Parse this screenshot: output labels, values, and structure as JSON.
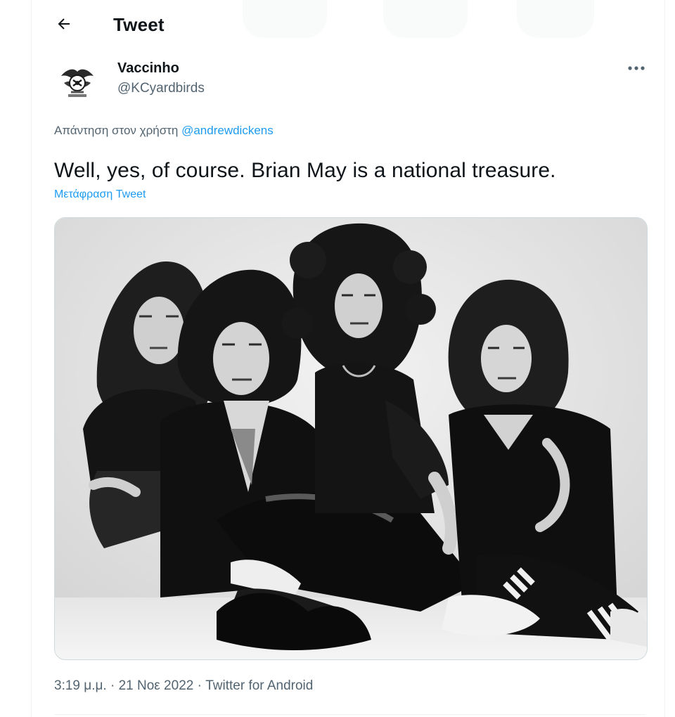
{
  "header": {
    "title": "Tweet",
    "back_icon": "arrow-left-icon"
  },
  "author": {
    "display_name": "Vaccinho",
    "handle": "@KCyardbirds",
    "avatar": "yardbirds-crest-avatar"
  },
  "reply": {
    "prefix": "Απάντηση στον χρήστη",
    "mention": "@andrewdickens"
  },
  "tweet": {
    "text": "Well, yes, of course. Brian May is a national treasure.",
    "translate_label": "Μετάφραση Tweet"
  },
  "media": {
    "description_icon": "band-photo-black-white"
  },
  "meta": {
    "time": "3:19 μ.μ.",
    "separator": "·",
    "date": "21 Νοε 2022",
    "source": "Twitter for Android"
  },
  "colors": {
    "accent": "#1d9bf0",
    "text": "#0f1419",
    "secondary": "#536471",
    "border": "#cfd9de"
  }
}
